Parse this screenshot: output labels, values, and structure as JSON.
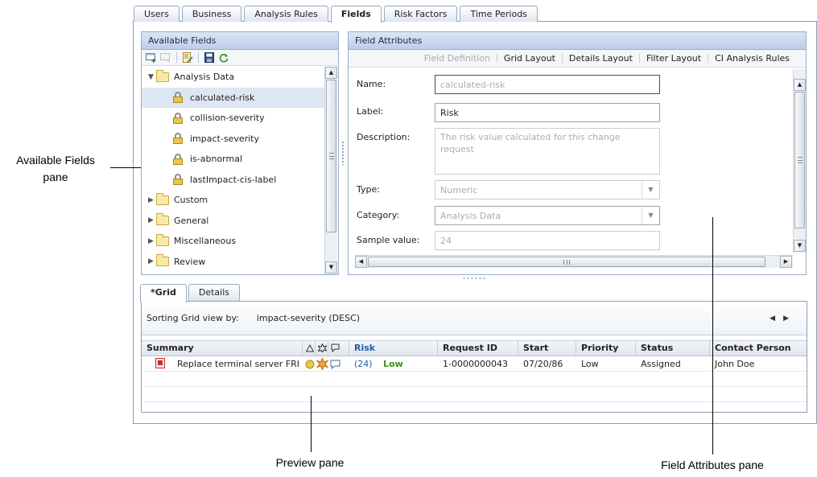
{
  "top_tabs": [
    "Users",
    "Business",
    "Analysis Rules",
    "Fields",
    "Risk Factors",
    "Time Periods"
  ],
  "active_top_tab": "Fields",
  "available_fields": {
    "title": "Available Fields",
    "toolbar_icons": [
      "new-field-icon",
      "new-disabled-icon",
      "edit-icon",
      "save-icon",
      "refresh-icon"
    ],
    "tree": [
      {
        "label": "Analysis Data",
        "type": "folder",
        "expanded": true
      },
      {
        "label": "calculated-risk",
        "type": "field",
        "selected": true
      },
      {
        "label": "collision-severity",
        "type": "field"
      },
      {
        "label": "impact-severity",
        "type": "field"
      },
      {
        "label": "is-abnormal",
        "type": "field"
      },
      {
        "label": "lastImpact-cis-label",
        "type": "field"
      },
      {
        "label": "Custom",
        "type": "folder"
      },
      {
        "label": "General",
        "type": "folder"
      },
      {
        "label": "Miscellaneous",
        "type": "folder"
      },
      {
        "label": "Review",
        "type": "folder"
      }
    ]
  },
  "field_attributes": {
    "title": "Field Attributes",
    "subtabs": [
      "Field Definition",
      "Grid Layout",
      "Details Layout",
      "Filter Layout",
      "CI Analysis Rules"
    ],
    "name_label": "Name:",
    "name_value": "calculated-risk",
    "label_label": "Label:",
    "label_value": "Risk",
    "description_label": "Description:",
    "description_value": "The risk value calculated for this change request",
    "type_label": "Type:",
    "type_value": "Numeric",
    "category_label": "Category:",
    "category_value": "Analysis Data",
    "sample_label": "Sample value:",
    "sample_value": "24"
  },
  "preview": {
    "tabs": [
      "*Grid",
      "Details"
    ],
    "sort_label": "Sorting Grid view by:",
    "sort_value": "impact-severity (DESC)",
    "columns": [
      "Summary",
      "Risk",
      "Request ID",
      "Start",
      "Priority",
      "Status",
      "Contact Person"
    ],
    "row": {
      "summary": "Replace terminal server FRI",
      "risk_value": "(24)",
      "risk_level": "Low",
      "request_id": "1-0000000043",
      "start": "07/20/86",
      "priority": "Low",
      "status": "Assigned",
      "contact": "John Doe"
    }
  },
  "callouts": {
    "available_fields": "Available Fields\npane",
    "preview": "Preview pane",
    "field_attributes": "Field Attributes pane"
  }
}
